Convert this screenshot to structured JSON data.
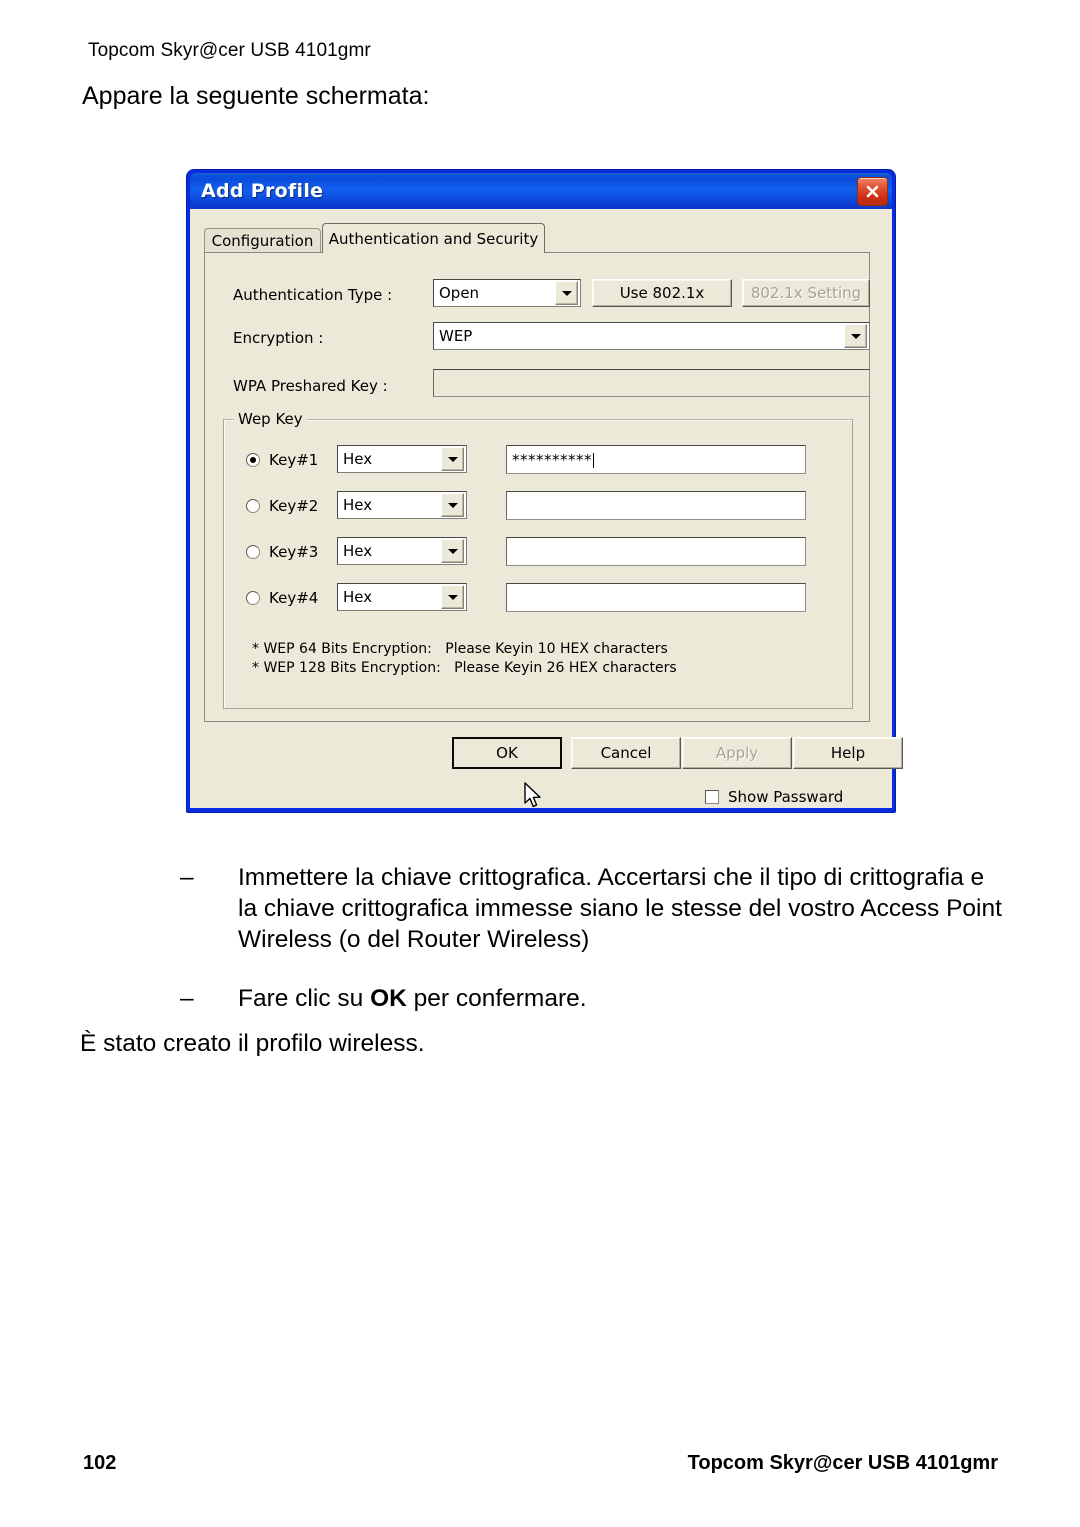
{
  "document": {
    "running_header": "Topcom Skyr@cer USB 4101gmr",
    "lead_text": "Appare la seguente schermata:",
    "bullets": [
      {
        "marker": "–",
        "text": "Immettere la chiave crittografica. Accertarsi che il tipo di crittografia e la chiave crittografica immesse siano le stesse del vostro Access Point Wireless (o del Router Wireless)"
      },
      {
        "marker": "–",
        "text_before": "Fare clic su ",
        "emphasis": "OK",
        "text_after": "  per confermare."
      }
    ],
    "closing_text": "È stato creato il profilo wireless.",
    "footer": {
      "page_number": "102",
      "title": "Topcom Skyr@cer USB 4101gmr"
    }
  },
  "dialog": {
    "title": "Add Profile",
    "close_icon": "close-icon",
    "titlebar_color": "#0b4ede",
    "face_color": "#ece9d8",
    "tabs": [
      {
        "label": "Configuration",
        "active": false
      },
      {
        "label": "Authentication and Security",
        "active": true
      }
    ],
    "fields": {
      "auth_type_label": "Authentication Type :",
      "auth_type_value": "Open",
      "use_8021x_label": "Use 802.1x",
      "setting_8021x_label": "802.1x Setting",
      "setting_8021x_disabled": true,
      "encryption_label": "Encryption :",
      "encryption_value": "WEP",
      "wpa_key_label": "WPA Preshared Key :",
      "wpa_key_value": "",
      "wpa_key_disabled": true
    },
    "wep_group": {
      "legend": "Wep Key",
      "keys": [
        {
          "label": "Key#1",
          "selected": true,
          "format": "Hex",
          "value": "**********"
        },
        {
          "label": "Key#2",
          "selected": false,
          "format": "Hex",
          "value": ""
        },
        {
          "label": "Key#3",
          "selected": false,
          "format": "Hex",
          "value": ""
        },
        {
          "label": "Key#4",
          "selected": false,
          "format": "Hex",
          "value": ""
        }
      ],
      "notes": [
        "* WEP 64 Bits Encryption:   Please Keyin 10 HEX characters",
        "* WEP 128 Bits Encryption:   Please Keyin 26 HEX characters"
      ]
    },
    "show_password": {
      "label": "Show Passward",
      "checked": false
    },
    "buttons": [
      {
        "label": "OK",
        "default": true,
        "disabled": false
      },
      {
        "label": "Cancel",
        "default": false,
        "disabled": false
      },
      {
        "label": "Apply",
        "default": false,
        "disabled": true
      },
      {
        "label": "Help",
        "default": false,
        "disabled": false
      }
    ]
  }
}
